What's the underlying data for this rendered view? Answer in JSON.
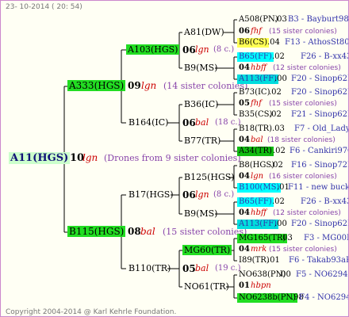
{
  "header": "23- 10-2014 ( 20: 54)",
  "footer": "Copyright 2004-2014 @ Karl Kehrle Foundation.",
  "colors": {
    "green": "#22dd22",
    "light_green": "#ccffcc",
    "yellow": "#ffff55",
    "cyan": "#00ffff",
    "blue_text": "#3333aa",
    "red_text": "#cc0000",
    "purple": "#8844aa"
  },
  "root": {
    "name": "A11(HGS)",
    "year": "10",
    "tag": "lgn",
    "drones": "(Drones from 9 sister colonies)"
  },
  "gen1": [
    {
      "name": "A333(HGS)",
      "year": "09",
      "tag": "lgn",
      "sisters": "(14 sister colonies)"
    },
    {
      "name": "B115(HGS)",
      "year": "08",
      "tag": "bal",
      "sisters": "(15 sister colonies)"
    }
  ],
  "gen2": [
    {
      "name": "A103(HGS)",
      "year": "06",
      "tag": "lgn",
      "sisters": "(8 c.)"
    },
    {
      "name": "B164(IC)",
      "year": "06",
      "tag": "bal",
      "sisters": "(18 c.)"
    },
    {
      "name": "B17(HGS)",
      "year": "06",
      "tag": "lgn",
      "sisters": "(8 c.)"
    },
    {
      "name": "B110(TR)",
      "year": "05",
      "tag": "bal",
      "sisters": "(19 c.)"
    }
  ],
  "gen3": [
    {
      "name": "A81(DW)"
    },
    {
      "name": "B9(MS)"
    },
    {
      "name": "B36(IC)"
    },
    {
      "name": "B77(TR)"
    },
    {
      "name": "B125(HGS)"
    },
    {
      "name": "B9(MS)"
    },
    {
      "name": "MG60(TR)"
    },
    {
      "name": "NO61(TR)"
    }
  ],
  "gen4": [
    {
      "name": "A508(PN)",
      "year": ".03",
      "right": "B3 - Bayburt98-3R"
    },
    {
      "year": "06",
      "tag": "fhf",
      "sisters": "(15 sister colonies)"
    },
    {
      "name": "B6(CS)",
      "year": ".04",
      "right": "F13 - AthosSt80R"
    },
    {
      "name": "B65(FF)",
      "year": ".02",
      "right": "F26 - B-xx43"
    },
    {
      "year": "04",
      "tag": "hbff",
      "sisters": "(12 sister colonies)"
    },
    {
      "name": "A113(FF)",
      "year": ".00",
      "right": "F20 - Sinop62R"
    },
    {
      "name": "B73(IC)",
      "year": ".02",
      "right": "F20 - Sinop62R"
    },
    {
      "year": "05",
      "tag": "fhf",
      "sisters": "(15 sister colonies)"
    },
    {
      "name": "B35(CS)",
      "year": ".02",
      "right": "F21 - Sinop62R"
    },
    {
      "name": "B18(TR)",
      "year": ".03",
      "right": "F7 - Old_Lady"
    },
    {
      "year": "04",
      "tag": "bal",
      "sisters": "(18 sister colonies)"
    },
    {
      "name": "A34(TR)",
      "year": ".02",
      "right": "F6 - Cankiri97Q"
    },
    {
      "name": "B8(HGS)",
      "year": ".02",
      "right": "F16 - Sinop72R"
    },
    {
      "year": "04",
      "tag": "lgn",
      "sisters": "(16 sister colonies)"
    },
    {
      "name": "B100(MS)",
      "year": ".01",
      "right": "F11 - new buckfast"
    },
    {
      "name": "B65(FF)",
      "year": ".02",
      "right": "F26 - B-xx43"
    },
    {
      "year": "04",
      "tag": "hbff",
      "sisters": "(12 sister colonies)"
    },
    {
      "name": "A113(FF)",
      "year": ".00",
      "right": "F20 - Sinop62R"
    },
    {
      "name": "MG165(TR)",
      "year": ".03",
      "right": "F3 - MG00R"
    },
    {
      "year": "04",
      "tag": "mrk",
      "sisters": "(15 sister colonies)"
    },
    {
      "name": "I89(TR)",
      "year": ".01",
      "right": "F6 - Takab93aR"
    },
    {
      "name": "NO638(PN)",
      "year": ".00",
      "right": "F5 - NO6294R"
    },
    {
      "year": "01",
      "tag": "hbpn",
      "sisters": ""
    },
    {
      "name": "NO6238b(PN)",
      "year": ".98",
      "right": "F4 - NO6294R"
    }
  ]
}
